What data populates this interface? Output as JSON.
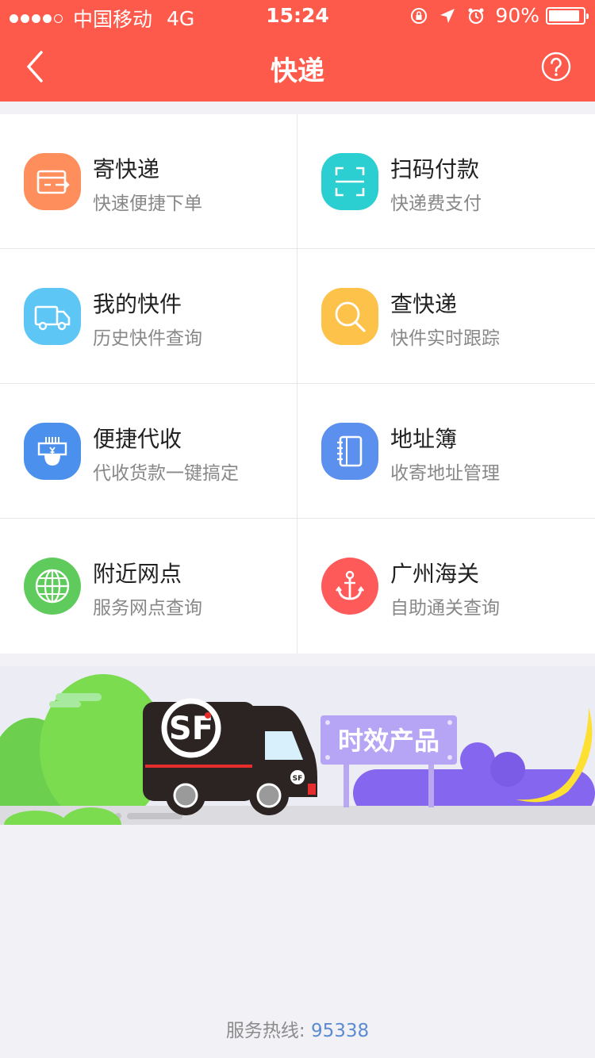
{
  "status_bar": {
    "carrier": "中国移动",
    "network": "4G",
    "time": "15:24",
    "battery_percent": "90%",
    "battery_level": 0.9
  },
  "nav": {
    "title": "快递"
  },
  "menu": [
    {
      "title": "寄快递",
      "subtitle": "快速便捷下单",
      "icon": "send-package-icon",
      "color": "#fe8e5c"
    },
    {
      "title": "扫码付款",
      "subtitle": "快递费支付",
      "icon": "scan-code-icon",
      "color": "#2ccfd1"
    },
    {
      "title": "我的快件",
      "subtitle": "历史快件查询",
      "icon": "truck-icon",
      "color": "#5ec6f5"
    },
    {
      "title": "查快递",
      "subtitle": "快件实时跟踪",
      "icon": "search-icon",
      "color": "#fdc24a"
    },
    {
      "title": "便捷代收",
      "subtitle": "代收货款一键搞定",
      "icon": "cash-on-delivery-icon",
      "color": "#4c90ee"
    },
    {
      "title": "地址簿",
      "subtitle": "收寄地址管理",
      "icon": "address-book-icon",
      "color": "#5b90ee"
    },
    {
      "title": "附近网点",
      "subtitle": "服务网点查询",
      "icon": "globe-icon",
      "color": "#5fcb5c"
    },
    {
      "title": "广州海关",
      "subtitle": "自助通关查询",
      "icon": "anchor-icon",
      "color": "#fe5a5a"
    }
  ],
  "banner": {
    "sign_text": "时效产品",
    "truck_logo": "SF"
  },
  "footer": {
    "label": "服务热线:",
    "phone": "95338"
  }
}
